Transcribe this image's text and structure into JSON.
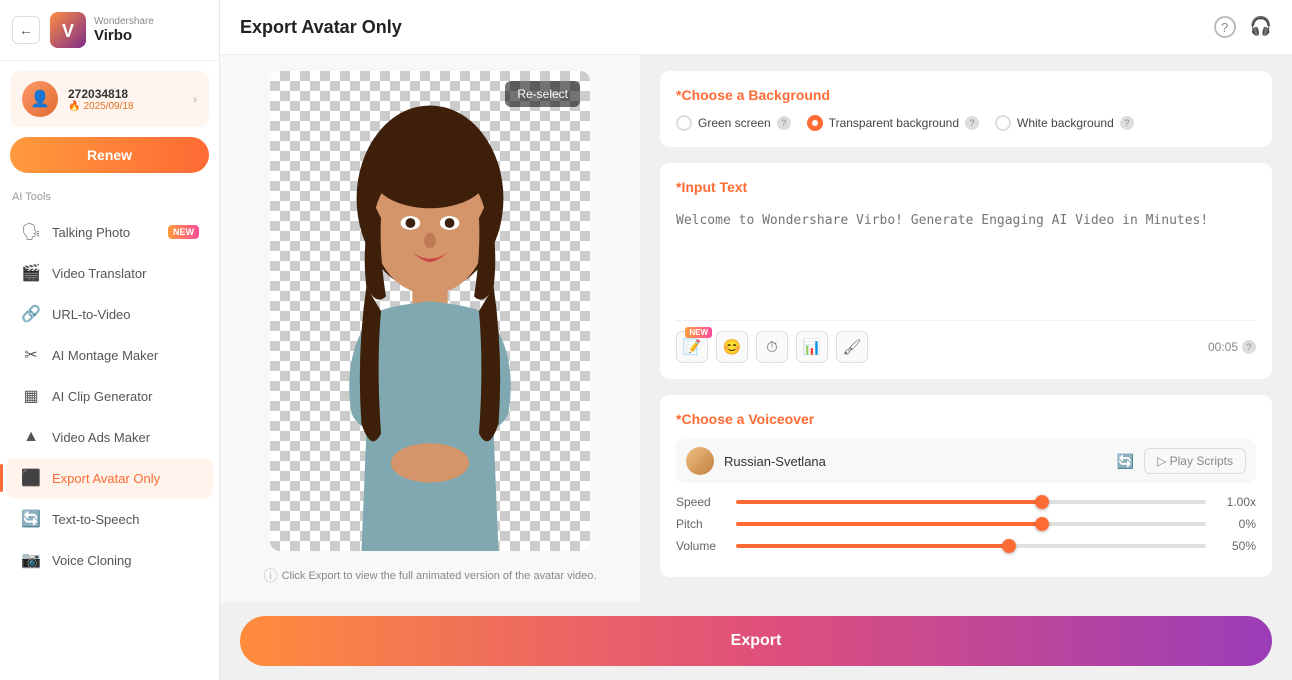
{
  "brand": {
    "company": "Wondershare",
    "product": "Virbo"
  },
  "user": {
    "id": "272034818",
    "expiry": "2025/09/18",
    "renew_label": "Renew"
  },
  "sidebar": {
    "ai_tools_label": "AI Tools",
    "items": [
      {
        "id": "talking-photo",
        "label": "Talking Photo",
        "icon": "🗣",
        "badge": "NEW"
      },
      {
        "id": "video-translator",
        "label": "Video Translator",
        "icon": "🎬"
      },
      {
        "id": "url-to-video",
        "label": "URL-to-Video",
        "icon": "🔗"
      },
      {
        "id": "ai-montage-maker",
        "label": "AI Montage Maker",
        "icon": "✂"
      },
      {
        "id": "ai-clip-generator",
        "label": "AI Clip Generator",
        "icon": "▦"
      },
      {
        "id": "video-ads-maker",
        "label": "Video Ads Maker",
        "icon": "▲"
      },
      {
        "id": "export-avatar-only",
        "label": "Export Avatar Only",
        "icon": "⬛",
        "active": true
      },
      {
        "id": "text-to-speech",
        "label": "Text-to-Speech",
        "icon": "🔄"
      },
      {
        "id": "voice-cloning",
        "label": "Voice Cloning",
        "icon": "📷"
      }
    ]
  },
  "page": {
    "title": "Export Avatar Only"
  },
  "header_icons": {
    "help": "?",
    "headset": "🎧"
  },
  "reselect_btn": "Re-select",
  "preview_hint": "Click Export to view the full animated version of the avatar video.",
  "background": {
    "section_title": "Choose a Background",
    "options": [
      {
        "id": "green-screen",
        "label": "Green screen",
        "selected": false
      },
      {
        "id": "transparent",
        "label": "Transparent background",
        "selected": true
      },
      {
        "id": "white",
        "label": "White background",
        "selected": false
      }
    ]
  },
  "input_text": {
    "section_title": "Input Text",
    "placeholder": "Welcome to Wondershare Virbo! Generate Engaging AI Video in Minutes!",
    "timer": "00:05",
    "toolbar_btns": [
      {
        "id": "new-feature",
        "icon": "📝",
        "has_new_badge": true
      },
      {
        "id": "emotion",
        "icon": "😊"
      },
      {
        "id": "pause",
        "icon": "⏱"
      },
      {
        "id": "emphasis",
        "icon": "📊"
      },
      {
        "id": "brush",
        "icon": "🖌"
      }
    ]
  },
  "voiceover": {
    "section_title": "Choose a Voiceover",
    "voice_name": "Russian-Svetlana",
    "play_scripts_label": "▷  Play Scripts",
    "speed_label": "Speed",
    "speed_value": "1.00x",
    "speed_pct": 65,
    "pitch_label": "Pitch",
    "pitch_value": "0%",
    "pitch_pct": 65,
    "volume_label": "Volume",
    "volume_value": "50%",
    "volume_pct": 58
  },
  "export_btn": "Export"
}
